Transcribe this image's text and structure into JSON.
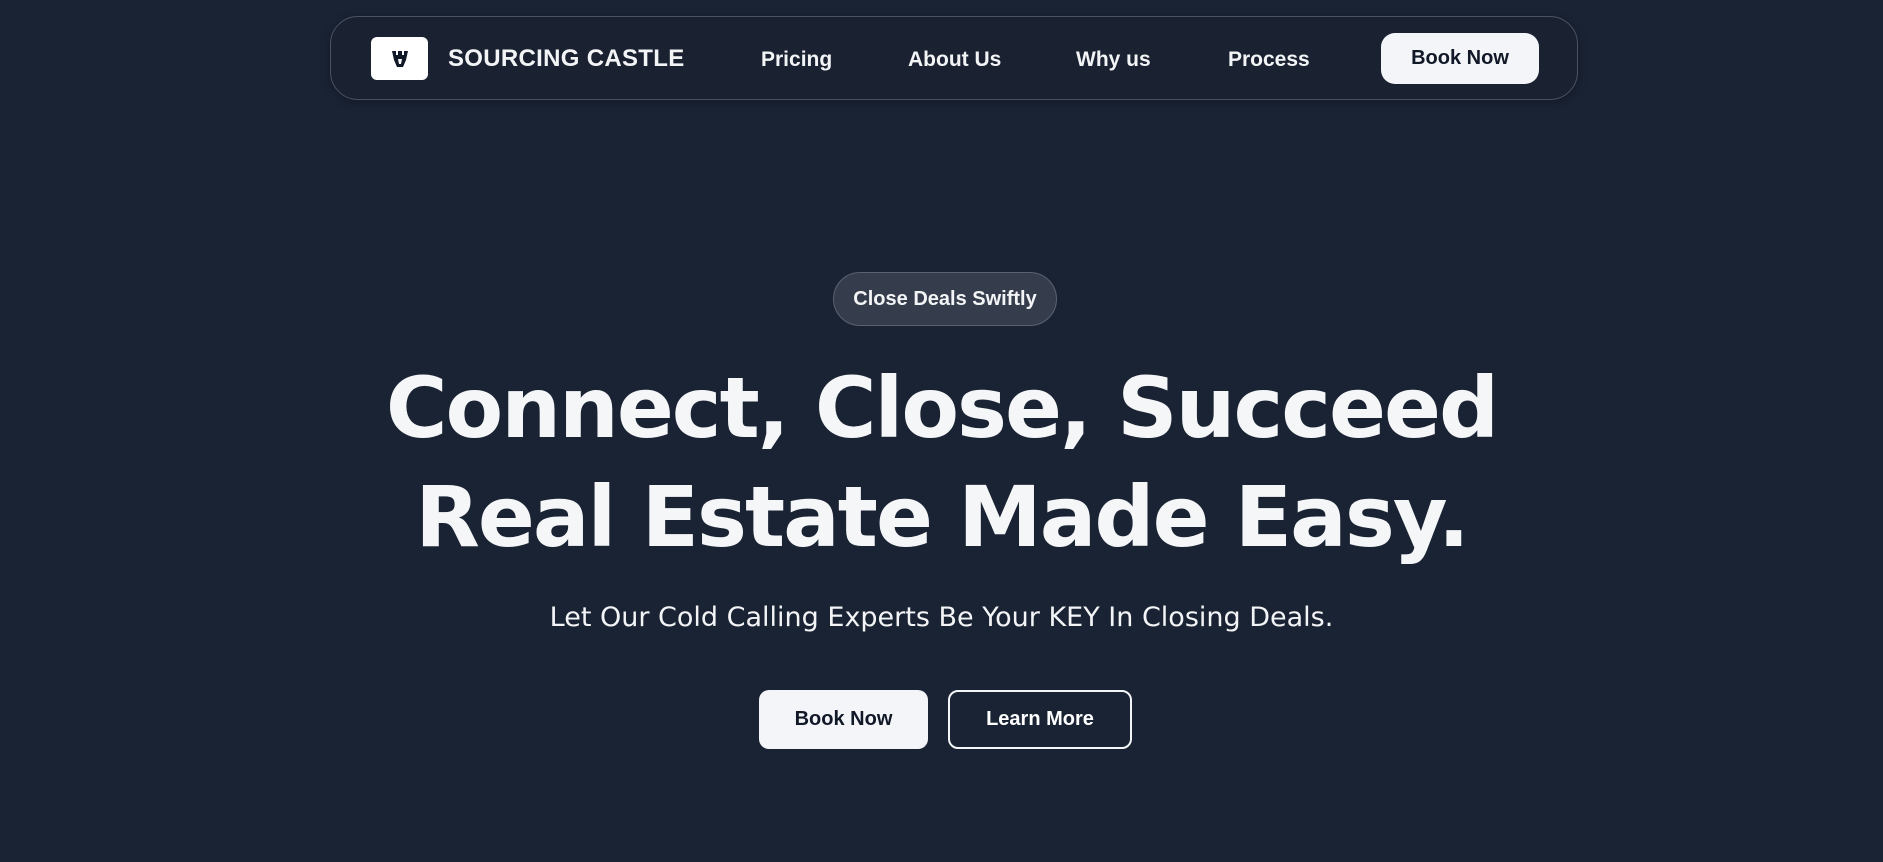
{
  "navbar": {
    "brand": "SOURCING CASTLE",
    "logo_icon": "castle-logo-icon",
    "links": [
      {
        "label": "Pricing"
      },
      {
        "label": "About Us"
      },
      {
        "label": "Why us"
      },
      {
        "label": "Process"
      }
    ],
    "cta_label": "Book Now"
  },
  "hero": {
    "badge": "Close Deals Swiftly",
    "headline_line1": "Connect, Close, Succeed",
    "headline_line2": "Real Estate Made Easy.",
    "subtitle": "Let Our Cold Calling Experts Be Your KEY In Closing Deals.",
    "primary_cta": "Book Now",
    "secondary_cta": "Learn More"
  },
  "colors": {
    "background": "#1a2334",
    "text": "#f3f4f6",
    "button_light": "#f3f5f8",
    "button_dark_text": "#111827"
  }
}
